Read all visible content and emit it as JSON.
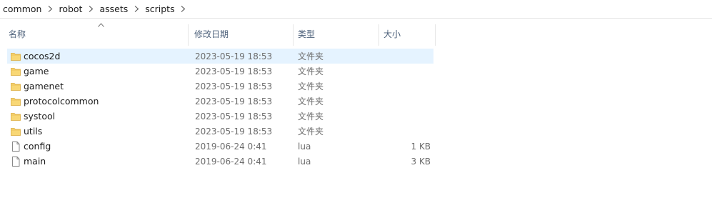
{
  "breadcrumb": [
    {
      "label": "common"
    },
    {
      "label": "robot"
    },
    {
      "label": "assets"
    },
    {
      "label": "scripts"
    }
  ],
  "columns": {
    "name": "名称",
    "date": "修改日期",
    "type": "类型",
    "size": "大小",
    "sorted_by": "name",
    "sort_direction": "ascending"
  },
  "files": [
    {
      "name": "cocos2d",
      "date": "2023-05-19 18:53",
      "type": "文件夹",
      "size": "",
      "icon": "folder-icon",
      "selected": true
    },
    {
      "name": "game",
      "date": "2023-05-19 18:53",
      "type": "文件夹",
      "size": "",
      "icon": "folder-icon",
      "selected": false
    },
    {
      "name": "gamenet",
      "date": "2023-05-19 18:53",
      "type": "文件夹",
      "size": "",
      "icon": "folder-icon",
      "selected": false
    },
    {
      "name": "protocolcommon",
      "date": "2023-05-19 18:53",
      "type": "文件夹",
      "size": "",
      "icon": "folder-icon",
      "selected": false
    },
    {
      "name": "systool",
      "date": "2023-05-19 18:53",
      "type": "文件夹",
      "size": "",
      "icon": "folder-icon",
      "selected": false
    },
    {
      "name": "utils",
      "date": "2023-05-19 18:53",
      "type": "文件夹",
      "size": "",
      "icon": "folder-icon",
      "selected": false
    },
    {
      "name": "config",
      "date": "2019-06-24 0:41",
      "type": "lua",
      "size": "1 KB",
      "icon": "file-icon",
      "selected": false
    },
    {
      "name": "main",
      "date": "2019-06-24 0:41",
      "type": "lua",
      "size": "3 KB",
      "icon": "file-icon",
      "selected": false
    }
  ],
  "colors": {
    "selection": "#e5f3ff",
    "folder": "#f8d775",
    "header_text": "#4c607a"
  }
}
